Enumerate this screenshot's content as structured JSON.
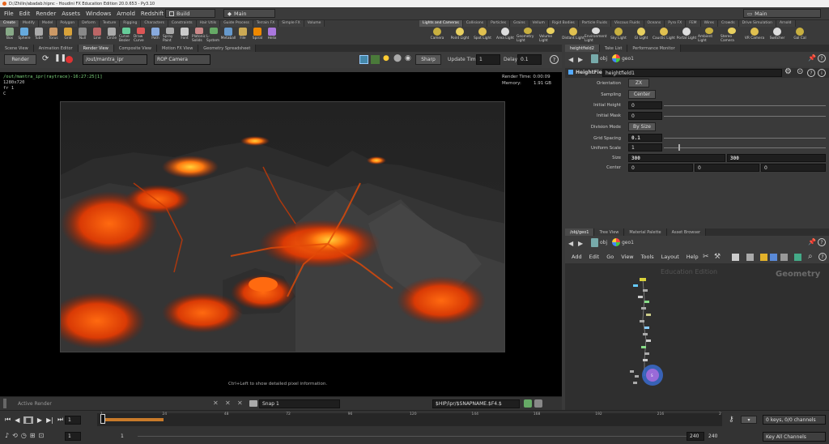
{
  "window": {
    "title": "D:/Zhilin/abadab.hipnc - Houdini FX Education Edition 20.0.653 - Py3.10"
  },
  "menu": {
    "items": [
      "File",
      "Edit",
      "Render",
      "Assets",
      "Windows",
      "Arnold",
      "Redshift",
      "Help"
    ],
    "build": "Build",
    "main": "Main",
    "desktop": "Main"
  },
  "shelf_tabs": [
    "Create",
    "Modify",
    "Model",
    "Polygon",
    "Deform",
    "Texture",
    "Rigging",
    "Characters",
    "Constraints",
    "Hair Utils",
    "Guide Process",
    "Terrain FX",
    "Simple FX",
    "Volume"
  ],
  "shelf_tools": [
    "Box",
    "Sphere",
    "Tube",
    "Torus",
    "Grid",
    "Null",
    "Line",
    "Circle",
    "Curve Bezier",
    "Draw Curve",
    "Path",
    "Spray Paint",
    "Font",
    "Platonic Solids",
    "L-System",
    "Metaball",
    "File",
    "Spiral",
    "Helix"
  ],
  "right_shelf_tabs": [
    "Lights and Cameras",
    "Collisions",
    "Particles",
    "Grains",
    "Vellum",
    "Rigid Bodies",
    "Particle Fluids",
    "Viscous Fluids",
    "Oceans",
    "Pyro FX",
    "FEM",
    "Wires",
    "Crowds",
    "Drive Simulation",
    "Arnold"
  ],
  "right_shelf_tools": [
    "Camera",
    "Point Light",
    "Spot Light",
    "Area Light",
    "Geometry Light",
    "Volume Light",
    "Distant Light",
    "Environment Light",
    "Sky Light",
    "GI Light",
    "Caustic Light",
    "Portal Light",
    "Ambient Light",
    "Stereo Camera",
    "VR Camera",
    "Switcher",
    "Gal Cal"
  ],
  "left_pane_tabs": [
    "Scene View",
    "Animation Editor",
    "Render View",
    "Composite View",
    "Motion FX View",
    "Geometry Spreadsheet"
  ],
  "render_toolbar": {
    "render_btn": "Render",
    "rop_path": "/out/mantra_ipr",
    "camera": "ROP Camera",
    "sharp": "Sharp",
    "update_label": "Update Time",
    "update_value": "1",
    "delay_label": "Delay",
    "delay_value": "0.1"
  },
  "render_info": {
    "path": "/out/mantra_ipr(raytrace)-16:27:25[1]",
    "res": "1280x720",
    "fr": "fr 1",
    "c": "C",
    "render_time": "Render Time: 0:00:09",
    "memory_label": "Memory:",
    "memory_value": "1.91 GB",
    "hint": "Ctrl+Left to show detailed pixel information."
  },
  "bottom_vp": {
    "active_render": "Active Render",
    "snap": "Snap 1",
    "snap_path": "$HIP/ipr/$SNAPNAME.$F4.$"
  },
  "params_tabs": [
    "heightfield2",
    "Take List",
    "Performance Monitor"
  ],
  "params_path": {
    "obj": "obj",
    "node": "geo1"
  },
  "params": {
    "node_type": "HeightField",
    "node_name": "heightfield1",
    "orientation_label": "Orientation",
    "orientation": "ZX",
    "sampling_label": "Sampling",
    "sampling": "Center",
    "init_height_label": "Initial Height",
    "init_height": "0",
    "init_mask_label": "Initial Mask",
    "init_mask": "0",
    "division_label": "Division Mode",
    "division": "By Size",
    "spacing_label": "Grid Spacing",
    "spacing": "0.1",
    "uniform_label": "Uniform Scale",
    "uniform": "1",
    "size_label": "Size",
    "size_x": "300",
    "size_y": "300",
    "center_label": "Center",
    "center_x": "0",
    "center_y": "0",
    "center_z": "0"
  },
  "net_tabs": [
    "/obj/geo1",
    "Tree View",
    "Material Palette",
    "Asset Browser"
  ],
  "net_menu": [
    "Add",
    "Edit",
    "Go",
    "View",
    "Tools",
    "Layout",
    "Help"
  ],
  "net_overlay": {
    "edition": "Education Edition",
    "context": "Geometry"
  },
  "timeline": {
    "ticks": [
      "1",
      "24",
      "48",
      "72",
      "96",
      "120",
      "144",
      "168",
      "192",
      "216",
      "2"
    ],
    "frame": "1",
    "start": "1",
    "start2": "1",
    "end": "240",
    "end2": "240",
    "keys": "0 keys, 0/0 channels",
    "key_all": "Key All Channels"
  }
}
